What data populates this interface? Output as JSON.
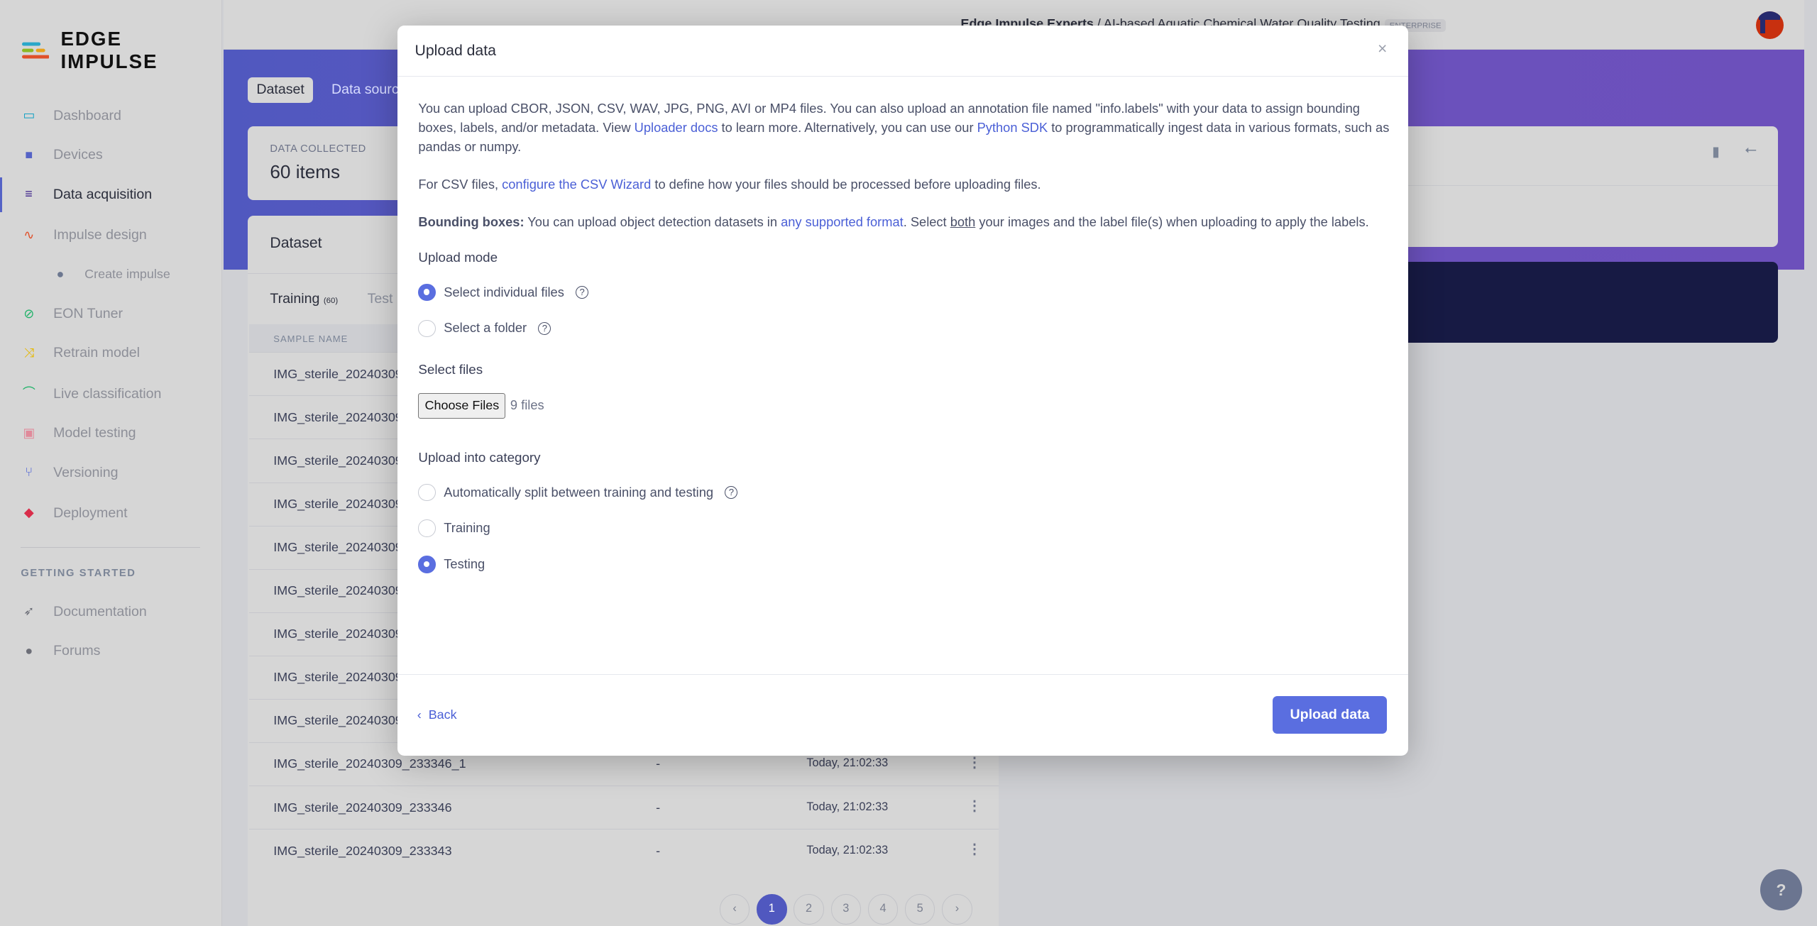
{
  "brand": {
    "name": "EDGE IMPULSE"
  },
  "sidebar": {
    "items": [
      {
        "label": "Dashboard",
        "icon": "monitor-icon",
        "color": "#17a2c4"
      },
      {
        "label": "Devices",
        "icon": "chip-icon",
        "color": "#5563c6"
      },
      {
        "label": "Data acquisition",
        "icon": "database-icon",
        "color": "#3b1f8a"
      },
      {
        "label": "Impulse design",
        "icon": "pulse-icon",
        "color": "#e0502a"
      },
      {
        "label": "Create impulse",
        "icon": "dot-icon",
        "color": "#6d7890"
      },
      {
        "label": "EON Tuner",
        "icon": "compass-icon",
        "color": "#22b36a"
      },
      {
        "label": "Retrain model",
        "icon": "shuffle-icon",
        "color": "#e6b800"
      },
      {
        "label": "Live classification",
        "icon": "bezier-icon",
        "color": "#22b36a"
      },
      {
        "label": "Model testing",
        "icon": "clipboard-check-icon",
        "color": "#e08a9a"
      },
      {
        "label": "Versioning",
        "icon": "branch-icon",
        "color": "#4a5fd6"
      },
      {
        "label": "Deployment",
        "icon": "cube-icon",
        "color": "#d92d4a"
      }
    ],
    "section": "GETTING STARTED",
    "help_items": [
      {
        "label": "Documentation",
        "icon": "rocket-icon"
      },
      {
        "label": "Forums",
        "icon": "chat-icon"
      }
    ]
  },
  "header": {
    "org": "Edge Impulse Experts",
    "sep": "/",
    "project": "AI-based Aquatic Chemical Water Quality Testing",
    "badge": "ENTERPRISE"
  },
  "tabs": {
    "dataset": "Dataset",
    "sources": "Data sources"
  },
  "data_collected": {
    "label": "DATA COLLECTED",
    "value": "60 items"
  },
  "dataset": {
    "title": "Dataset",
    "training": "Training",
    "training_count": "(60)",
    "test": "Test",
    "col_name": "SAMPLE NAME",
    "rows": [
      {
        "name": "IMG_sterile_20240309",
        "label": "",
        "date": ""
      },
      {
        "name": "IMG_sterile_20240309",
        "label": "",
        "date": ""
      },
      {
        "name": "IMG_sterile_20240309",
        "label": "",
        "date": ""
      },
      {
        "name": "IMG_sterile_20240309",
        "label": "",
        "date": ""
      },
      {
        "name": "IMG_sterile_20240309",
        "label": "",
        "date": ""
      },
      {
        "name": "IMG_sterile_20240309",
        "label": "",
        "date": ""
      },
      {
        "name": "IMG_sterile_20240309",
        "label": "",
        "date": ""
      },
      {
        "name": "IMG_sterile_20240309",
        "label": "",
        "date": ""
      },
      {
        "name": "IMG_sterile_20240309",
        "label": "",
        "date": ""
      },
      {
        "name": "IMG_sterile_20240309_233346_1",
        "label": "-",
        "date": "Today, 21:02:33"
      },
      {
        "name": "IMG_sterile_20240309_233346",
        "label": "-",
        "date": "Today, 21:02:33"
      },
      {
        "name": "IMG_sterile_20240309_233343",
        "label": "-",
        "date": "Today, 21:02:33"
      }
    ],
    "pages": [
      "1",
      "2",
      "3",
      "4",
      "5"
    ],
    "current_page": "1"
  },
  "modal": {
    "title": "Upload data",
    "close": "×",
    "p1a": "You can upload CBOR, JSON, CSV, WAV, JPG, PNG, AVI or MP4 files. You can also upload an annotation file named \"info.labels\" with your data to assign bounding boxes, labels, and/or metadata. View ",
    "p1_link1": "Uploader docs",
    "p1b": " to learn more. Alternatively, you can use our ",
    "p1_link2": "Python SDK",
    "p1c": " to programmatically ingest data in various formats, such as pandas or numpy.",
    "p2a": "For CSV files, ",
    "p2_link": "configure the CSV Wizard",
    "p2b": " to define how your files should be processed before uploading files.",
    "p3_bold": "Bounding boxes:",
    "p3a": " You can upload object detection datasets in ",
    "p3_link": "any supported format",
    "p3b": ". Select ",
    "p3_u": "both",
    "p3c": " your images and the label file(s) when uploading to apply the labels.",
    "upload_mode": "Upload mode",
    "mode_options": [
      "Select individual files",
      "Select a folder"
    ],
    "mode_selected": "Select individual files",
    "select_files": "Select files",
    "choose_files": "Choose Files",
    "file_count": "9 files",
    "category": "Upload into category",
    "category_options": [
      "Automatically split between training and testing",
      "Training",
      "Testing"
    ],
    "category_selected": "Testing",
    "back": "Back",
    "upload": "Upload data"
  },
  "colors": {
    "accent": "#5a6ee0",
    "hero": "#6a52bd"
  }
}
